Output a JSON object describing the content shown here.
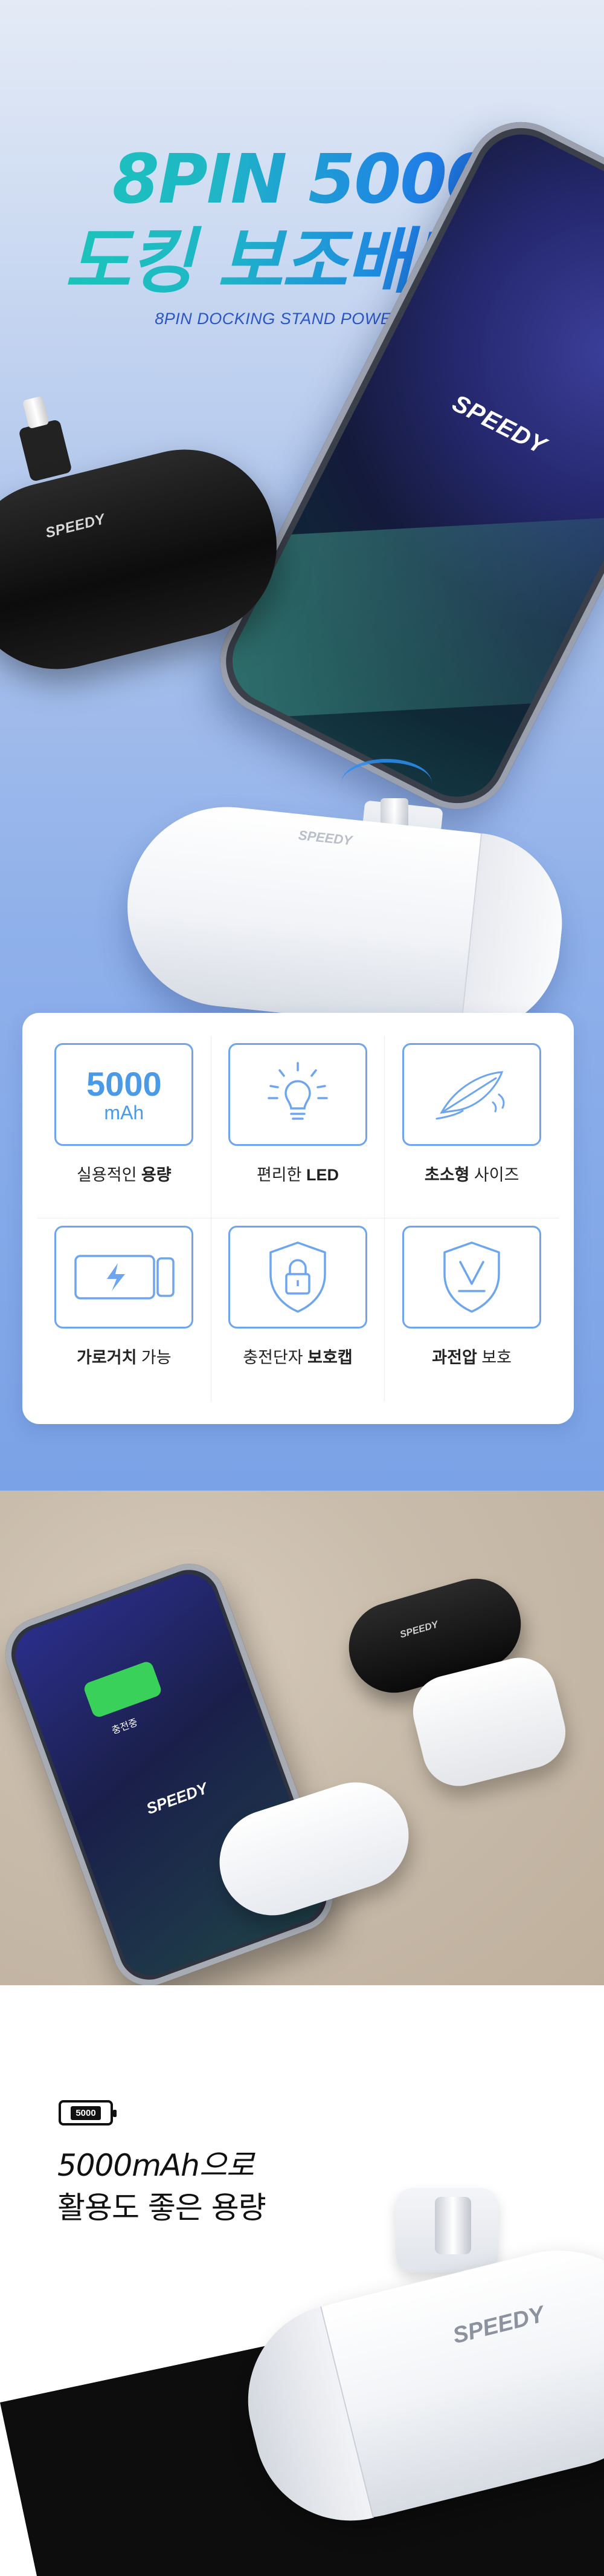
{
  "hero": {
    "title_line1": "8PIN 5000",
    "title_line2": "도킹 보조배터리",
    "subtitle": "8PIN DOCKING STAND POWERBANK",
    "brand_logo": "SPEEDY"
  },
  "features": [
    {
      "icon": "5000-mah-icon",
      "value": "5000",
      "unit": "mAh",
      "label_plain": "실용적인 ",
      "label_bold": "용량",
      "bold_first": false
    },
    {
      "icon": "led-bulb-icon",
      "label_plain": "편리한 ",
      "label_bold": "LED",
      "bold_first": false
    },
    {
      "icon": "feather-icon",
      "label_bold": "초소형",
      "label_plain": " 사이즈",
      "bold_first": true
    },
    {
      "icon": "battery-charging-icon",
      "label_bold": "가로거치",
      "label_plain": " 가능",
      "bold_first": true
    },
    {
      "icon": "lock-shield-icon",
      "label_plain": "충전단자 ",
      "label_bold": "보호캡",
      "bold_first": false
    },
    {
      "icon": "voltage-shield-icon",
      "label_bold": "과전압",
      "label_plain": " 보호",
      "bold_first": true
    }
  ],
  "photo": {
    "screen_status": "충전중",
    "brand_logo": "SPEEDY"
  },
  "capacity": {
    "badge": "5000",
    "line1": "5000mAh으로",
    "line2": "활용도 좋은 용량",
    "brand_logo": "SPEEDY"
  },
  "colors": {
    "accent_blue": "#4a9ae8",
    "title_gradient_start": "#19c9b5",
    "title_gradient_end": "#1f5fd9",
    "battery_green": "#3ad15a"
  }
}
